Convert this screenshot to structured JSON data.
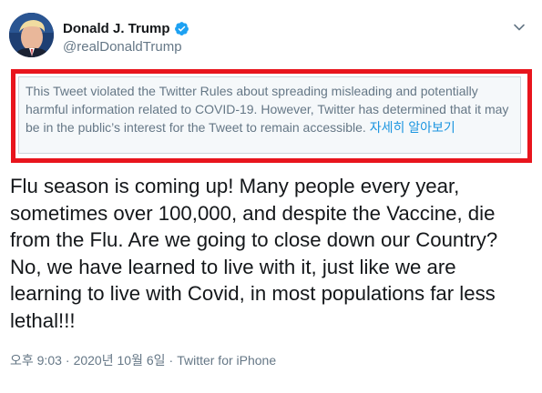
{
  "user": {
    "display_name": "Donald J. Trump",
    "handle": "@realDonaldTrump",
    "verified": true,
    "avatar_icon": "profile-avatar"
  },
  "menu": {
    "icon": "chevron-down-icon"
  },
  "notice": {
    "text": "This Tweet violated the Twitter Rules about spreading misleading and potentially harmful information related to COVID-19. However, Twitter has determined that it may be in the public’s interest for the Tweet to remain accessible.",
    "link_label": "자세히 알아보기",
    "highlight_color": "#e8151d"
  },
  "tweet": {
    "text": "Flu season is coming up! Many people every year, sometimes over 100,000, and despite the Vaccine, die from the Flu. Are we going to close down our Country? No, we have learned to live with it, just like we are learning to live with Covid, in most populations far less lethal!!!"
  },
  "meta": {
    "time": "오후 9:03",
    "separator": "·",
    "date": "2020년 10월 6일",
    "source": "Twitter for iPhone"
  },
  "colors": {
    "link": "#1b95e0",
    "secondary_text": "#657786",
    "verified": "#1da1f2"
  }
}
